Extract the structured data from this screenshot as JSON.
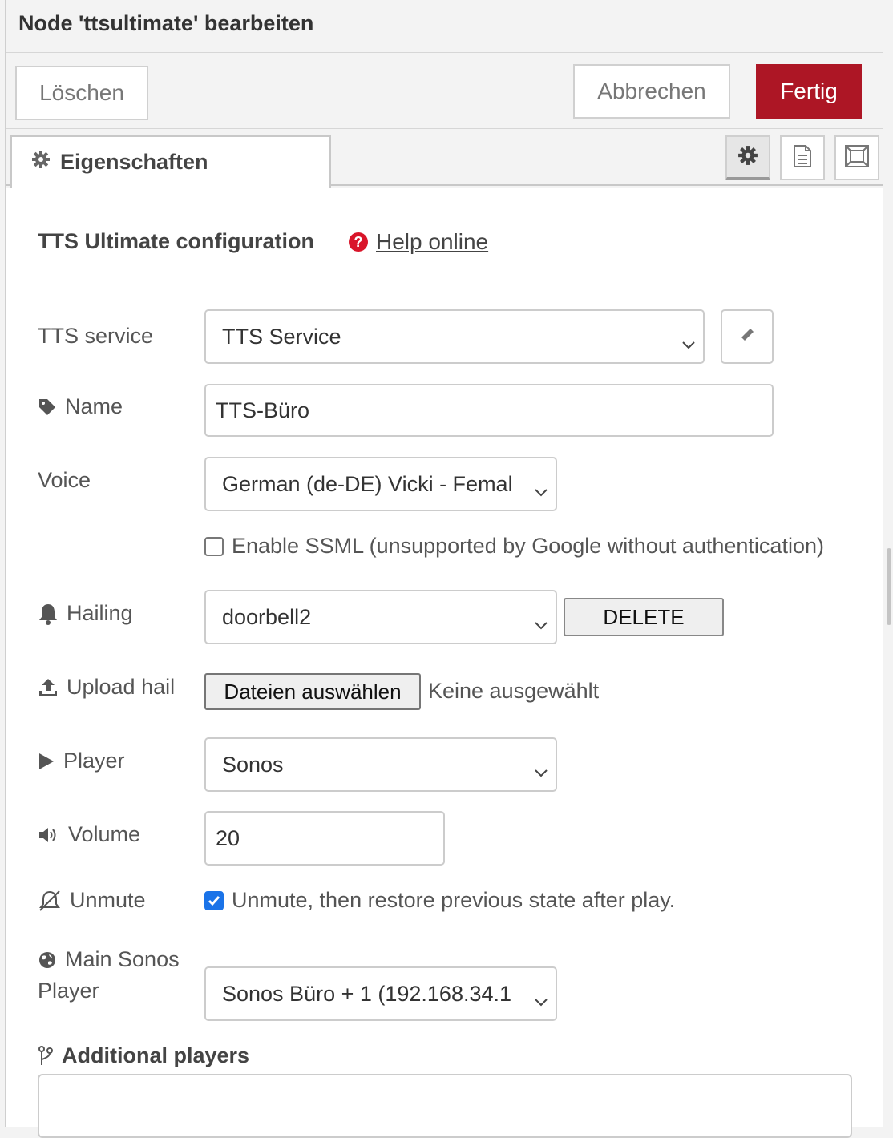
{
  "header": {
    "title": "Node 'ttsultimate' bearbeiten"
  },
  "toolbar": {
    "delete_label": "Löschen",
    "cancel_label": "Abbrechen",
    "done_label": "Fertig",
    "done_color": "#ad1625"
  },
  "tabs": {
    "properties_label": "Eigenschaften",
    "icons": [
      "gear-icon",
      "description-icon",
      "appearance-icon"
    ]
  },
  "form": {
    "section_title": "TTS Ultimate configuration",
    "help_link": "Help online",
    "tts_service": {
      "label": "TTS service",
      "value": "TTS Service"
    },
    "name": {
      "label": "Name",
      "value": "TTS-Büro"
    },
    "voice": {
      "label": "Voice",
      "value": "German (de-DE) Vicki - Femal"
    },
    "ssml": {
      "label": "Enable SSML (unsupported by Google without authentication)",
      "checked": false
    },
    "hailing": {
      "label": "Hailing",
      "value": "doorbell2",
      "delete_label": "DELETE"
    },
    "upload": {
      "label": "Upload hail",
      "button_label": "Dateien auswählen",
      "status": "Keine ausgewählt"
    },
    "player": {
      "label": "Player",
      "value": "Sonos"
    },
    "volume": {
      "label": "Volume",
      "value": "20"
    },
    "unmute": {
      "label": "Unmute",
      "checkbox_label": "Unmute, then restore previous state after play.",
      "checked": true
    },
    "main_player": {
      "label_line1": "Main Sonos",
      "label_line2": "Player",
      "value": "Sonos Büro + 1 (192.168.34.1"
    },
    "additional_players": {
      "label": "Additional players"
    }
  }
}
